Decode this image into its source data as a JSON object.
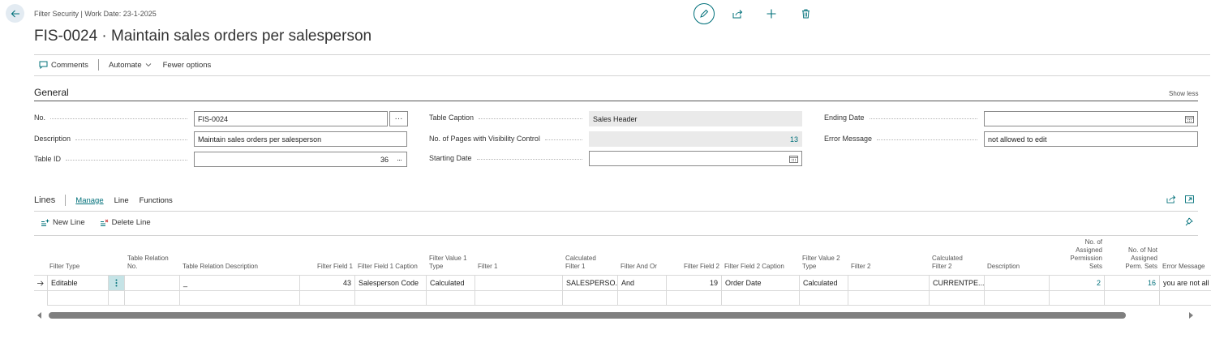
{
  "header": {
    "context": "Filter Security | Work Date: 23-1-2025",
    "title": "FIS-0024 · Maintain sales orders per salesperson"
  },
  "actionbar": {
    "comments": "Comments",
    "automate": "Automate",
    "fewer_options": "Fewer options"
  },
  "general": {
    "title": "General",
    "show_less": "Show less",
    "no_label": "No.",
    "no_value": "FIS-0024",
    "description_label": "Description",
    "description_value": "Maintain sales orders per salesperson",
    "table_id_label": "Table ID",
    "table_id_value": "36",
    "table_caption_label": "Table Caption",
    "table_caption_value": "Sales Header",
    "pages_label": "No. of Pages with Visibility Control",
    "pages_value": "13",
    "starting_date_label": "Starting Date",
    "starting_date_value": "",
    "ending_date_label": "Ending Date",
    "ending_date_value": "",
    "error_message_label": "Error Message",
    "error_message_value": "not allowed to edit"
  },
  "lines": {
    "title": "Lines",
    "tabs": [
      "Manage",
      "Line",
      "Functions"
    ],
    "new_line": "New Line",
    "delete_line": "Delete Line",
    "columns": [
      [
        "Filter Type"
      ],
      [
        ""
      ],
      [
        "Table Relation",
        "No."
      ],
      [
        "Table Relation Description"
      ],
      [
        "Filter Field 1"
      ],
      [
        "Filter Field 1 Caption"
      ],
      [
        "Filter Value 1",
        "Type"
      ],
      [
        "Filter 1"
      ],
      [
        "Calculated",
        "Filter 1"
      ],
      [
        "Filter And Or"
      ],
      [
        "Filter Field 2"
      ],
      [
        "Filter Field 2 Caption"
      ],
      [
        "Filter Value 2",
        "Type"
      ],
      [
        "Filter 2"
      ],
      [
        "Calculated",
        "Filter 2"
      ],
      [
        "Description"
      ],
      [
        "No. of",
        "Assigned",
        "Permission",
        "Sets"
      ],
      [
        "No. of Not",
        "Assigned",
        "Perm. Sets"
      ],
      [
        "Error Message"
      ]
    ],
    "row": [
      "Editable",
      "",
      "",
      "_",
      "43",
      "Salesperson Code",
      "Calculated",
      "",
      "SALESPERSO...",
      "And",
      "19",
      "Order Date",
      "Calculated",
      "",
      "CURRENTPE...",
      "",
      "2",
      "16",
      "you are not all"
    ]
  }
}
